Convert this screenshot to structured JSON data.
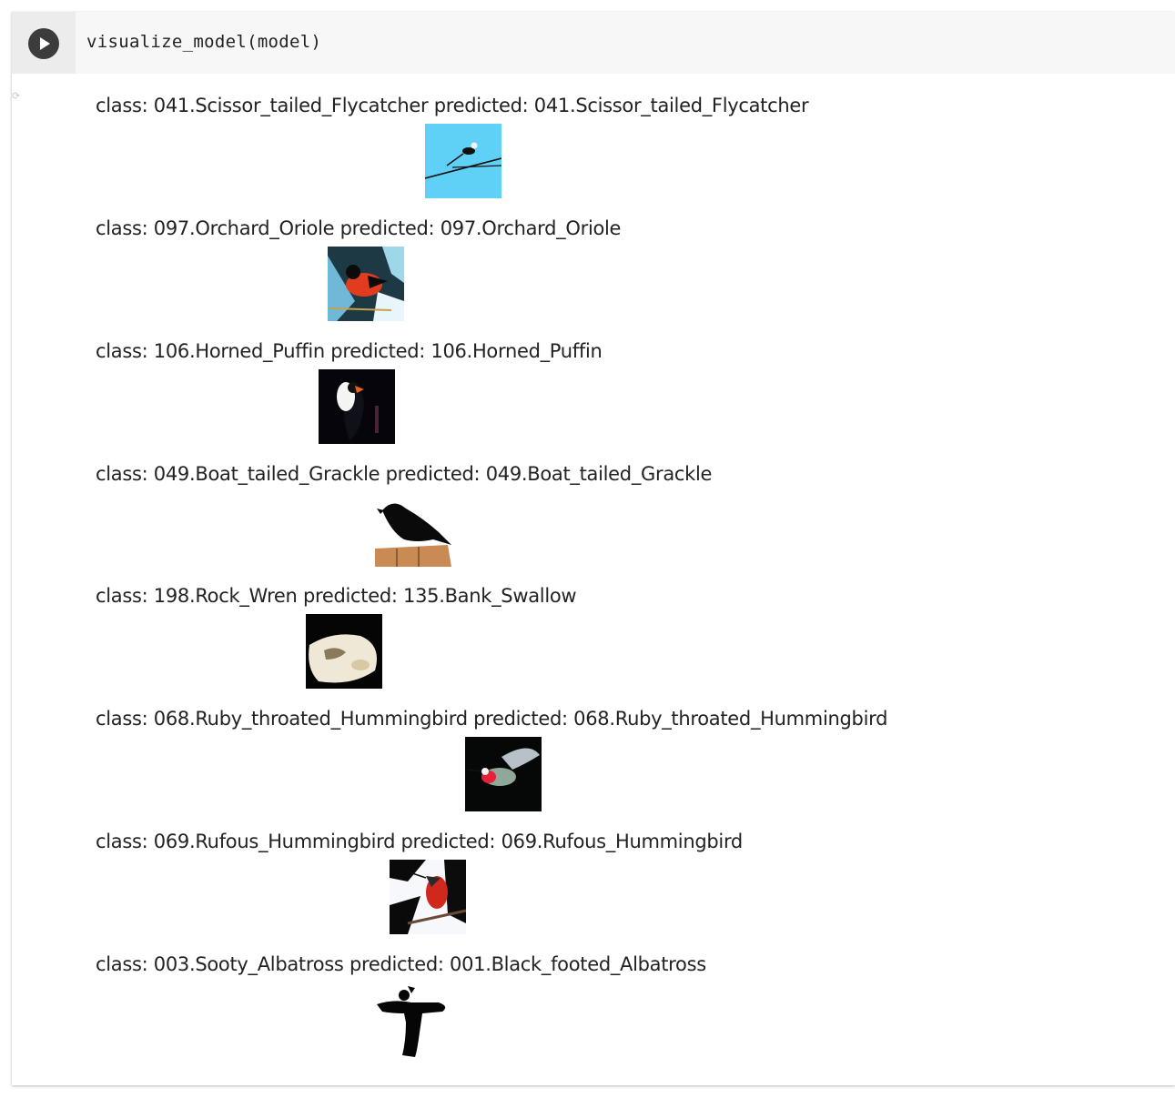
{
  "cell": {
    "code": "visualize_model(model)",
    "run_button_icon": "play-icon",
    "status_icon": "checkmark-icon"
  },
  "outputs": [
    {
      "class_name": "041.Scissor_tailed_Flycatcher",
      "predicted": "041.Scissor_tailed_Flycatcher",
      "label": "class: 041.Scissor_tailed_Flycatcher predicted: 041.Scissor_tailed_Flycatcher"
    },
    {
      "class_name": "097.Orchard_Oriole",
      "predicted": "097.Orchard_Oriole",
      "label": "class: 097.Orchard_Oriole predicted: 097.Orchard_Oriole"
    },
    {
      "class_name": "106.Horned_Puffin",
      "predicted": "106.Horned_Puffin",
      "label": "class: 106.Horned_Puffin predicted: 106.Horned_Puffin"
    },
    {
      "class_name": "049.Boat_tailed_Grackle",
      "predicted": "049.Boat_tailed_Grackle",
      "label": "class: 049.Boat_tailed_Grackle predicted: 049.Boat_tailed_Grackle"
    },
    {
      "class_name": "198.Rock_Wren",
      "predicted": "135.Bank_Swallow",
      "label": "class: 198.Rock_Wren predicted: 135.Bank_Swallow"
    },
    {
      "class_name": "068.Ruby_throated_Hummingbird",
      "predicted": "068.Ruby_throated_Hummingbird",
      "label": "class: 068.Ruby_throated_Hummingbird predicted: 068.Ruby_throated_Hummingbird"
    },
    {
      "class_name": "069.Rufous_Hummingbird",
      "predicted": "069.Rufous_Hummingbird",
      "label": "class: 069.Rufous_Hummingbird predicted: 069.Rufous_Hummingbird"
    },
    {
      "class_name": "003.Sooty_Albatross",
      "predicted": "001.Black_footed_Albatross",
      "label": "class: 003.Sooty_Albatross predicted: 001.Black_footed_Albatross"
    }
  ]
}
